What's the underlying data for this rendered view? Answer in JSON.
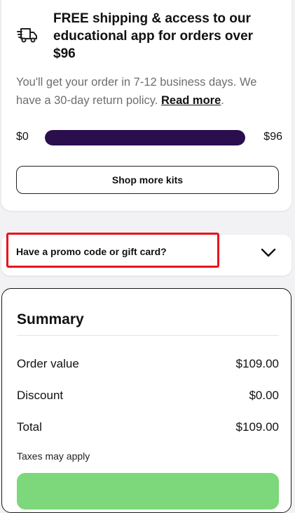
{
  "shipping": {
    "icon": "truck-icon",
    "title": "FREE shipping & access to our educational app for orders over $96",
    "body_text": "You'll get your order in 7-12 business days. We have a 30-day return policy.",
    "read_more": "Read more",
    "period": ".",
    "progress": {
      "min_label": "$0",
      "max_label": "$96",
      "fill_fraction": 1.0,
      "bar_color": "#2a0e4e"
    },
    "shop_button": "Shop more kits"
  },
  "promo": {
    "label": "Have a promo code or gift card?",
    "icon": "chevron-down-icon",
    "highlight_color": "#e8141e"
  },
  "summary": {
    "title": "Summary",
    "rows": [
      {
        "label": "Order value",
        "value": "$109.00"
      },
      {
        "label": "Discount",
        "value": "$0.00"
      },
      {
        "label": "Total",
        "value": "$109.00"
      }
    ],
    "taxes_note": "Taxes may apply",
    "checkout_color": "#7cd87a"
  }
}
